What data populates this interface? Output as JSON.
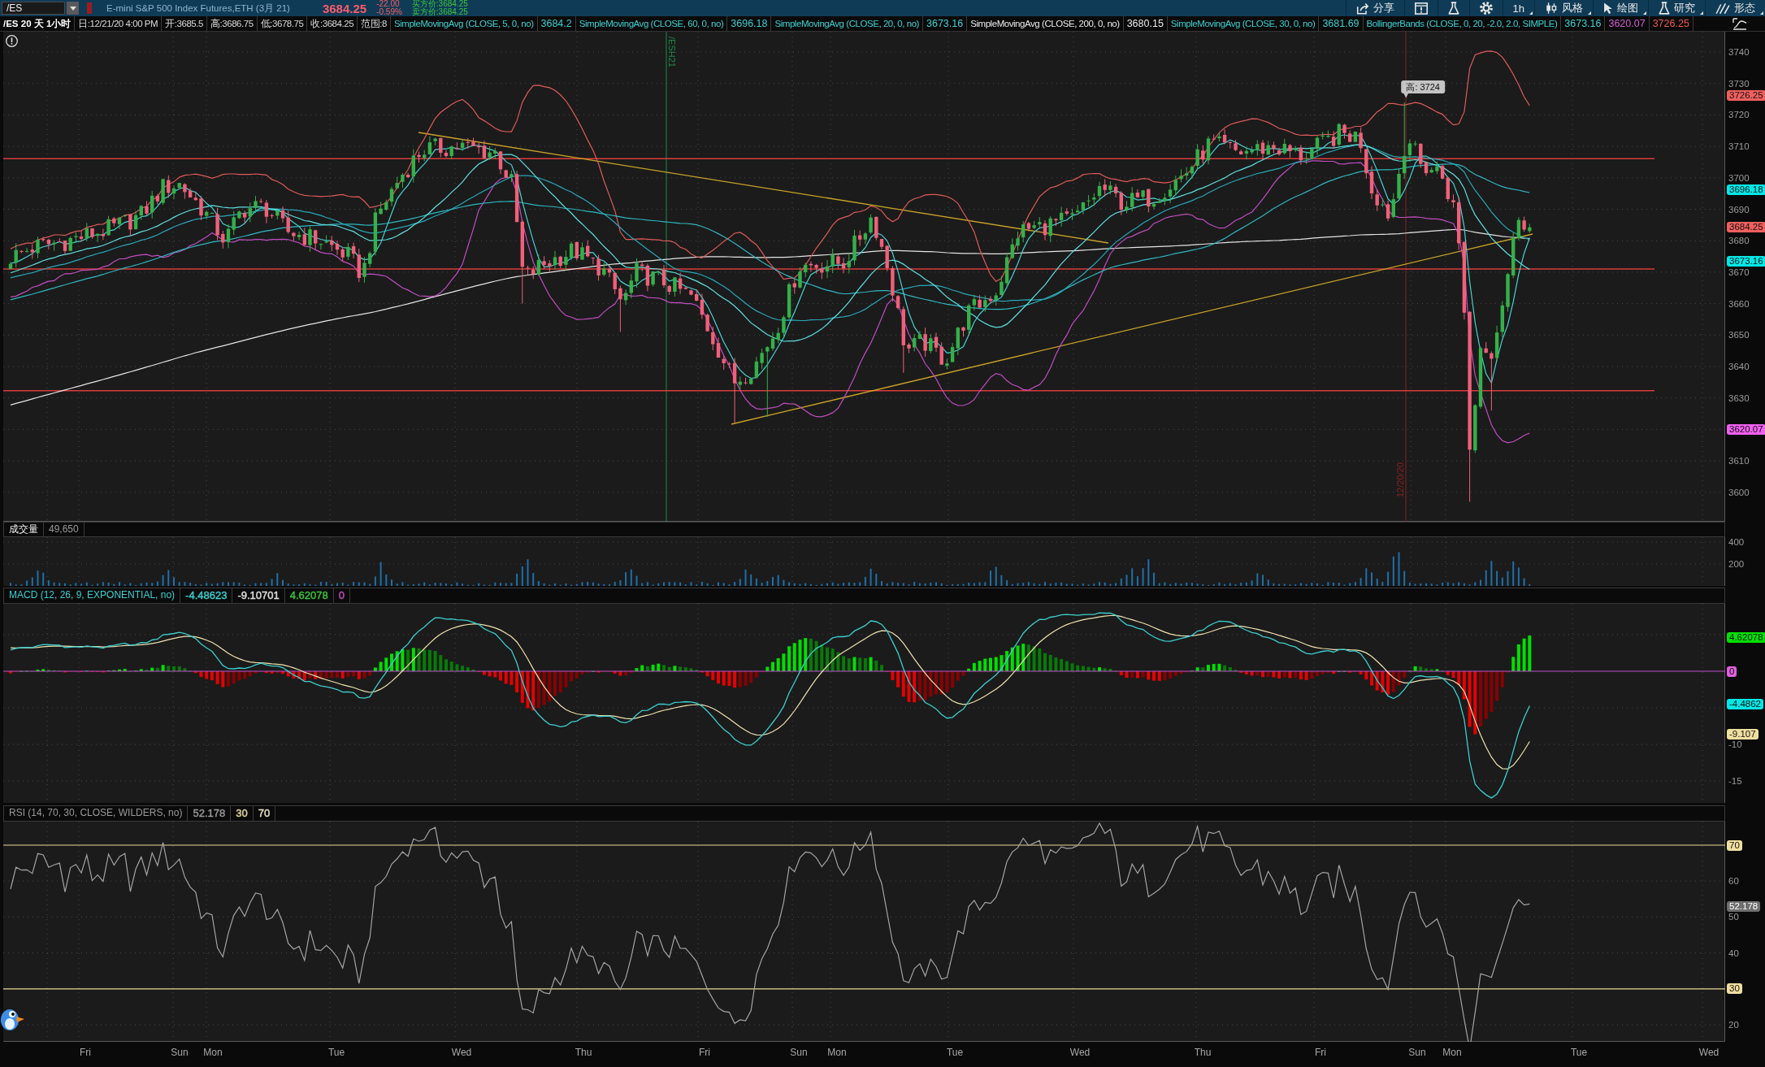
{
  "header": {
    "symbol": "/ES",
    "description": "E-mini S&P 500 Index Futures,ETH (3月 21)",
    "last": "3684.25",
    "change": "-22.00",
    "change_percent": "-0.59%",
    "bid": "买方价:3684.25",
    "ask": "卖方价:3684.25",
    "tools": [
      {
        "kind": "share",
        "label": "分享"
      },
      {
        "kind": "detach"
      },
      {
        "kind": "lab"
      },
      {
        "kind": "settings"
      },
      {
        "kind": "interval",
        "label": "1h"
      },
      {
        "kind": "style",
        "label": "风格"
      },
      {
        "kind": "drawing",
        "label": "绘图"
      },
      {
        "kind": "studies",
        "label": "研究"
      },
      {
        "kind": "patterns",
        "label": "形态"
      }
    ]
  },
  "info_strip": {
    "title": "/ES 20 天 1小时",
    "fields": [
      "日:12/21/20 4:00 PM",
      "开:3685.5",
      "高:3686.75",
      "低:3678.75",
      "收:3684.25",
      "范围:8"
    ],
    "studies": [
      {
        "label": "SimpleMovingAvg (CLOSE, 5, 0, no)",
        "color": "#3ccfcf",
        "values": [
          {
            "text": "3684.2",
            "color": "#3ccfcf"
          }
        ]
      },
      {
        "label": "SimpleMovingAvg (CLOSE, 60, 0, no)",
        "color": "#3ccfcf",
        "values": [
          {
            "text": "3696.18",
            "color": "#3ccfcf"
          }
        ]
      },
      {
        "label": "SimpleMovingAvg (CLOSE, 20, 0, no)",
        "color": "#3ccfcf",
        "values": [
          {
            "text": "3673.16",
            "color": "#3ccfcf"
          }
        ]
      },
      {
        "label": "SimpleMovingAvg (CLOSE, 200, 0, no)",
        "color": "#e8e8e8",
        "values": [
          {
            "text": "3680.15",
            "color": "#e8e8e8"
          }
        ]
      },
      {
        "label": "SimpleMovingAvg (CLOSE, 30, 0, no)",
        "color": "#3ccfcf",
        "values": [
          {
            "text": "3681.69",
            "color": "#3ccfcf"
          }
        ]
      },
      {
        "label": "BollingerBands (CLOSE, 0, 20, -2.0, 2.0, SIMPLE)",
        "color": "#3ccfcf",
        "values": [
          {
            "text": "3673.16",
            "color": "#3ccfcf"
          },
          {
            "text": "3620.07",
            "color": "#d45ad4"
          },
          {
            "text": "3726.25",
            "color": "#f0564e"
          }
        ]
      }
    ]
  },
  "price_panel": {
    "axis_ticks": [
      "3740",
      "3730",
      "3720",
      "3710",
      "3700",
      "3690",
      "3680",
      "3670",
      "3660",
      "3650",
      "3640",
      "3630",
      "3610",
      "3600"
    ],
    "badges": [
      {
        "text": "3726.25",
        "color": "#f0605e"
      },
      {
        "text": "3696.18",
        "color": "#00e8e8"
      },
      {
        "text": "3684.25",
        "color": "#f0605e"
      },
      {
        "text": "3673.16",
        "color": "#00e8e8"
      },
      {
        "text": "3620.07",
        "color": "#f060f0"
      }
    ],
    "high_callout": "高: 3724",
    "markers": [
      {
        "kind": "expiry",
        "text": "/ESH21"
      },
      {
        "kind": "date",
        "text": "12/20/20"
      }
    ]
  },
  "volume_panel": {
    "label": "成交量",
    "value": "49,650",
    "axis_ticks": [
      "400",
      "200"
    ]
  },
  "macd_panel": {
    "label": "MACD (12, 26, 9, EXPONENTIAL, no)",
    "values": [
      {
        "text": "-4.48623",
        "color": "#3ccfcf"
      },
      {
        "text": "-9.10701",
        "color": "#e0e0e0"
      },
      {
        "text": "4.62078",
        "color": "#3cc83c"
      },
      {
        "text": "0",
        "color": "#c050c0"
      }
    ],
    "axis_ticks": [
      "-10",
      "-15"
    ],
    "badges": [
      {
        "text": "4.62078",
        "color": "#00e000"
      },
      {
        "text": "0",
        "color": "#e060e0"
      },
      {
        "text": "-4.4862",
        "color": "#00e8e8"
      },
      {
        "text": "-9.107",
        "color": "#f0e0a0"
      }
    ]
  },
  "rsi_panel": {
    "label": "RSI (14, 70, 30, CLOSE, WILDERS, no)",
    "values": [
      {
        "text": "52.178",
        "color": "#9a9a9a"
      },
      {
        "text": "30",
        "color": "#e8d8a0"
      },
      {
        "text": "70",
        "color": "#ece4c8"
      }
    ],
    "axis_ticks": [
      "60",
      "50",
      "40",
      "20"
    ],
    "badges": [
      {
        "text": "70",
        "color": "#f0e0a0"
      },
      {
        "text": "52.178",
        "color": "#6e6e6e"
      },
      {
        "text": "30",
        "color": "#f0e0a0"
      }
    ]
  },
  "time_axis": [
    "Fri",
    "Sun",
    "Mon",
    "Tue",
    "Wed",
    "Thu",
    "Fri",
    "Sun",
    "Mon",
    "Tue",
    "Wed",
    "Thu",
    "Fri",
    "Sun",
    "Mon",
    "Tue",
    "Wed"
  ]
}
